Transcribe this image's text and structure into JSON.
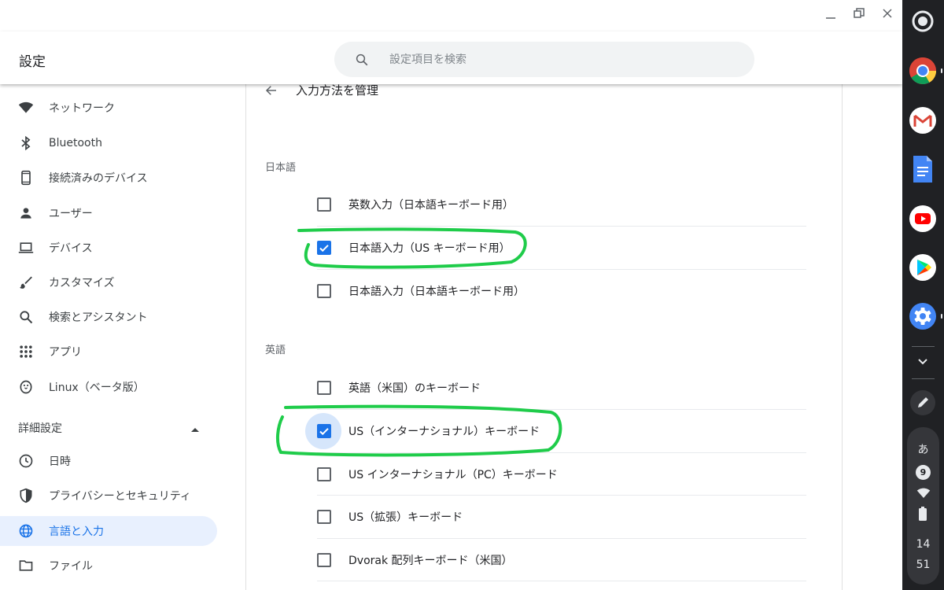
{
  "app": {
    "title": "設定",
    "search_placeholder": "設定項目を検索"
  },
  "sidebar": {
    "items": [
      {
        "label": "ネットワーク",
        "icon": "wifi-icon"
      },
      {
        "label": "Bluetooth",
        "icon": "bluetooth-icon"
      },
      {
        "label": "接続済みのデバイス",
        "icon": "phone-icon"
      },
      {
        "label": "ユーザー",
        "icon": "person-icon"
      },
      {
        "label": "デバイス",
        "icon": "laptop-icon"
      },
      {
        "label": "カスタマイズ",
        "icon": "brush-icon"
      },
      {
        "label": "検索とアシスタント",
        "icon": "search-icon"
      },
      {
        "label": "アプリ",
        "icon": "apps-grid-icon"
      },
      {
        "label": "Linux（ベータ版）",
        "icon": "penguin-icon"
      }
    ],
    "advanced_label": "詳細設定",
    "advanced_items": [
      {
        "label": "日時",
        "icon": "clock-icon"
      },
      {
        "label": "プライバシーとセキュリティ",
        "icon": "shield-icon"
      },
      {
        "label": "言語と入力",
        "icon": "globe-icon",
        "active": true
      },
      {
        "label": "ファイル",
        "icon": "folder-icon"
      }
    ]
  },
  "main": {
    "page_title": "入力方法を管理",
    "groups": [
      {
        "label": "日本語",
        "items": [
          {
            "label": "英数入力（日本語キーボード用）",
            "checked": false
          },
          {
            "label": "日本語入力（US キーボード用）",
            "checked": true
          },
          {
            "label": "日本語入力（日本語キーボード用）",
            "checked": false
          }
        ]
      },
      {
        "label": "英語",
        "items": [
          {
            "label": "英語（米国）のキーボード",
            "checked": false
          },
          {
            "label": "US（インターナショナル）キーボード",
            "checked": true
          },
          {
            "label": "US インターナショナル（PC）キーボード",
            "checked": false
          },
          {
            "label": "US（拡張）キーボード",
            "checked": false
          },
          {
            "label": "Dvorak 配列キーボード（米国）",
            "checked": false
          }
        ]
      }
    ]
  },
  "shelf": {
    "apps": [
      "launcher-icon",
      "chrome-icon",
      "gmail-icon",
      "docs-icon",
      "youtube-icon",
      "play-store-icon",
      "settings-app-icon"
    ],
    "ime_indicator": "あ",
    "notification_count": "9",
    "clock_hour": "14",
    "clock_minute": "51"
  },
  "colors": {
    "accent": "#1a73e8",
    "annotation": "#1fcc4a",
    "shelf": "#202124"
  }
}
